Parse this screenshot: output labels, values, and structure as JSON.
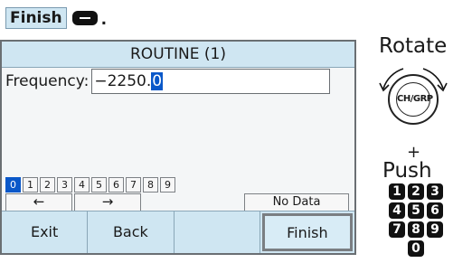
{
  "instruction": {
    "button_label": "Finish",
    "key_icon": "minus-key-icon",
    "period": "."
  },
  "screen": {
    "title": "ROUTINE (1)",
    "frequency_label": "Frequency:",
    "frequency_value": "−2250.",
    "frequency_cursor": "0",
    "digit_keys": [
      "0",
      "1",
      "2",
      "3",
      "4",
      "5",
      "6",
      "7",
      "8",
      "9"
    ],
    "left_arrow": "←",
    "right_arrow": "→",
    "no_data_label": "No Data",
    "softkeys": {
      "exit": "Exit",
      "back": "Back",
      "blank": "",
      "finish": "Finish"
    }
  },
  "controls": {
    "rotate_label": "Rotate",
    "knob_label": "CH/GRP",
    "plus": "+",
    "push_label": "Push",
    "keypad": [
      "1",
      "2",
      "3",
      "4",
      "5",
      "6",
      "7",
      "8",
      "9",
      "0"
    ]
  },
  "colors": {
    "accent": "#cfe6f2",
    "cursor": "#0a58c9"
  }
}
